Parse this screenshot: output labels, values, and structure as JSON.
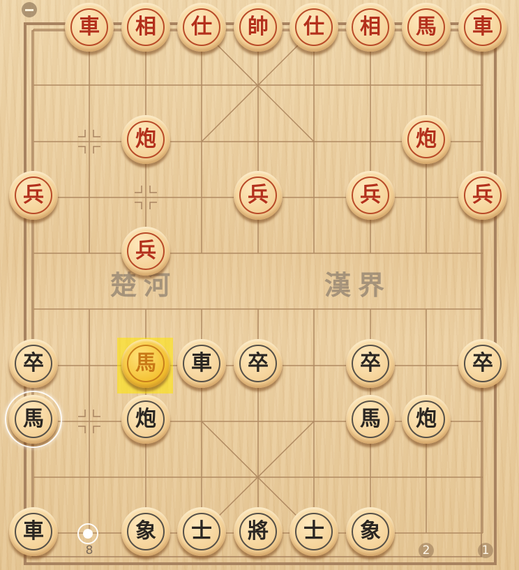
{
  "board": {
    "river_left": "楚河",
    "river_right": "漢界"
  },
  "file_labels": {
    "left": "8",
    "mid": "2",
    "right": "1"
  },
  "pieces": {
    "red": {
      "chariot_left": "車",
      "elephant_left": "相",
      "advisor_left": "仕",
      "general": "帥",
      "advisor_right": "仕",
      "elephant_right": "相",
      "horse_right": "馬",
      "chariot_right": "車",
      "cannon_left": "炮",
      "cannon_right": "炮",
      "soldier_1": "兵",
      "soldier_2": "兵",
      "soldier_3": "兵",
      "soldier_4": "兵",
      "soldier_5": "兵"
    },
    "black": {
      "horse_moved": "馬",
      "chariot_river": "車",
      "pawn_1": "卒",
      "pawn_2": "卒",
      "pawn_3": "卒",
      "pawn_4": "卒",
      "horse_selected": "馬",
      "cannon_left": "炮",
      "horse_right": "馬",
      "cannon_right": "炮",
      "chariot_left": "車",
      "elephant_left": "象",
      "advisor_left": "士",
      "general": "將",
      "advisor_right": "士",
      "elephant_right": "象"
    }
  },
  "colors": {
    "red_text": "#b3301c",
    "black_text": "#2a2622",
    "last_move_highlight": "#ffe600",
    "board_line": "#9a7650"
  }
}
